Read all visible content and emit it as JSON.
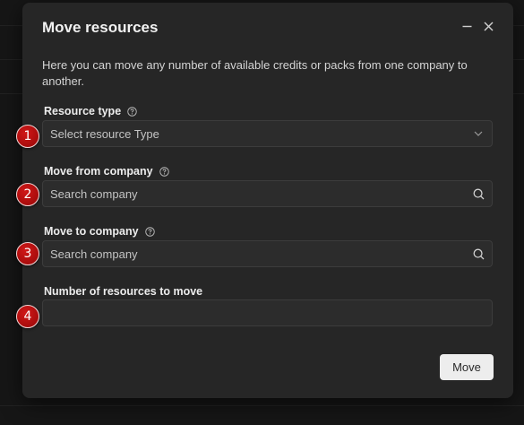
{
  "dialog": {
    "title": "Move resources",
    "description": "Here you can move any number of available credits or packs from one company to another.",
    "header_icons": [
      "minimize-icon",
      "close-icon"
    ]
  },
  "fields": {
    "resource_type": {
      "label": "Resource type",
      "placeholder": "Select resource Type",
      "icon": "chevron-down-icon",
      "help_icon": "help-icon"
    },
    "move_from": {
      "label": "Move from company",
      "placeholder": "Search company",
      "icon": "search-icon",
      "help_icon": "help-icon"
    },
    "move_to": {
      "label": "Move to company",
      "placeholder": "Search company",
      "icon": "search-icon",
      "help_icon": "help-icon"
    },
    "count": {
      "label": "Number of resources to move",
      "value": ""
    }
  },
  "actions": {
    "move_label": "Move"
  },
  "markers": [
    "1",
    "2",
    "3",
    "4"
  ],
  "colors": {
    "dialog_bg": "#262626",
    "input_bg": "#2c2c2c",
    "marker_red": "#b00f0f",
    "button_bg": "#ededed"
  }
}
